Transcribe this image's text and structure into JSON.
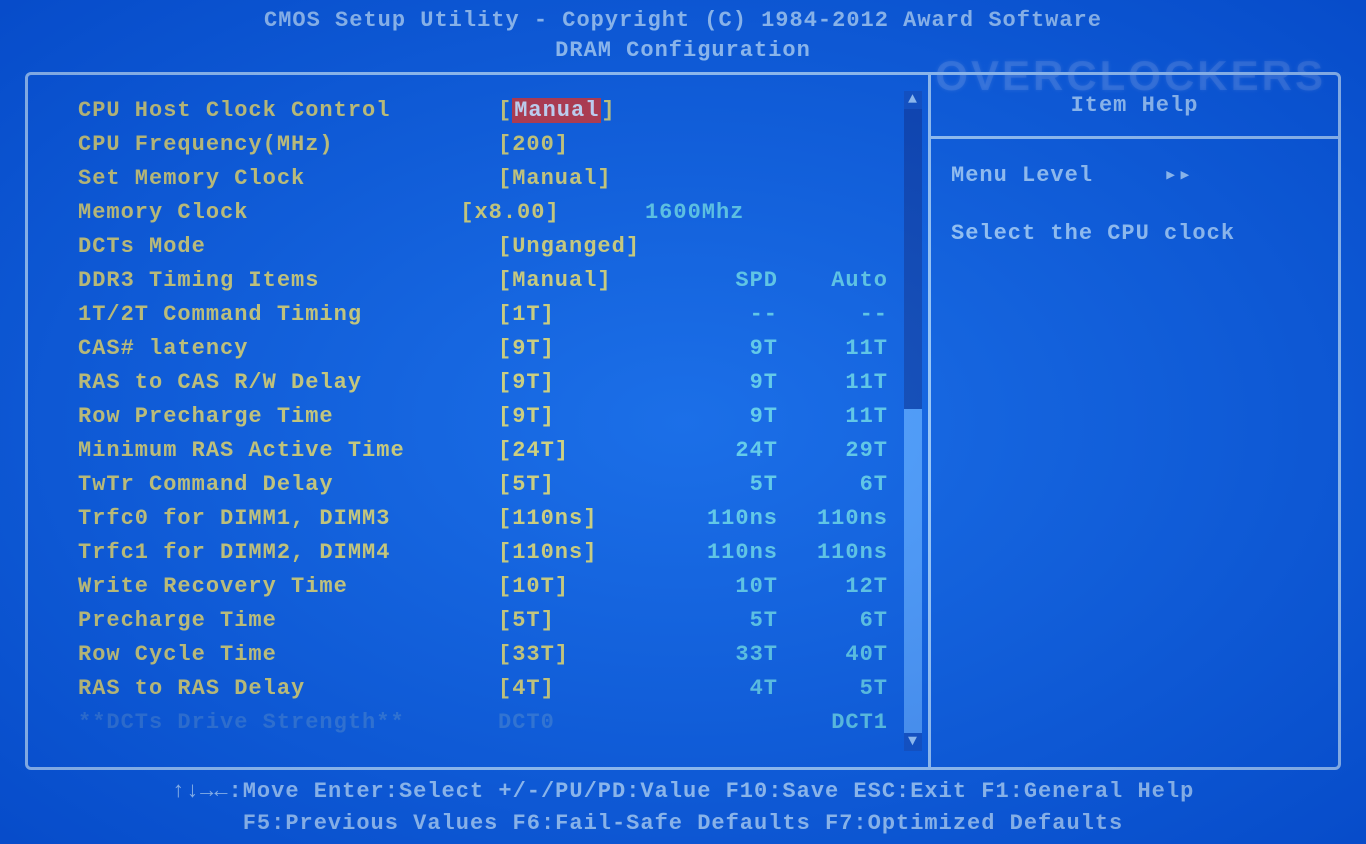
{
  "header": {
    "title": "CMOS Setup Utility - Copyright (C) 1984-2012 Award Software",
    "subtitle": "DRAM Configuration"
  },
  "watermark": "OVERCLOCKERS",
  "settings": [
    {
      "label": "CPU Host Clock Control",
      "value": "Manual",
      "selected": true
    },
    {
      "label": "CPU Frequency(MHz)",
      "value": "200"
    },
    {
      "label": "Set Memory Clock",
      "value": "Manual"
    },
    {
      "label": "Memory Clock",
      "value": "x8.00",
      "note": "1600Mhz"
    },
    {
      "label": "DCTs Mode",
      "value": "Unganged"
    },
    {
      "label": "DDR3 Timing Items",
      "value": "Manual",
      "spd": "SPD",
      "auto": "Auto"
    },
    {
      "label": "1T/2T Command Timing",
      "value": "1T",
      "spd": "--",
      "auto": "--"
    },
    {
      "label": "CAS# latency",
      "value": "9T",
      "spd": "9T",
      "auto": "11T"
    },
    {
      "label": "RAS to CAS R/W Delay",
      "value": "9T",
      "spd": "9T",
      "auto": "11T"
    },
    {
      "label": "Row Precharge Time",
      "value": "9T",
      "spd": "9T",
      "auto": "11T"
    },
    {
      "label": "Minimum RAS Active Time",
      "value": "24T",
      "spd": "24T",
      "auto": "29T"
    },
    {
      "label": "TwTr Command Delay",
      "value": "5T",
      "spd": "5T",
      "auto": "6T"
    },
    {
      "label": "Trfc0 for DIMM1, DIMM3",
      "value": "110ns",
      "spd": "110ns",
      "auto": "110ns"
    },
    {
      "label": "Trfc1 for DIMM2, DIMM4",
      "value": "110ns",
      "spd": "110ns",
      "auto": "110ns"
    },
    {
      "label": "Write Recovery Time",
      "value": "10T",
      "spd": "10T",
      "auto": "12T"
    },
    {
      "label": "Precharge Time",
      "value": "5T",
      "spd": "5T",
      "auto": "6T"
    },
    {
      "label": "Row Cycle Time",
      "value": "33T",
      "spd": "33T",
      "auto": "40T"
    },
    {
      "label": "RAS to RAS Delay",
      "value": "4T",
      "spd": "4T",
      "auto": "5T"
    },
    {
      "label": "**DCTs Drive Strength**",
      "raw_value": "DCT0",
      "raw_auto": "DCT1",
      "dim": true
    }
  ],
  "help": {
    "title": "Item Help",
    "menu_level_label": "Menu Level",
    "menu_level_icon": "▸▸",
    "body": "Select the CPU clock"
  },
  "footer": {
    "line1": "↑↓→←:Move   Enter:Select   +/-/PU/PD:Value   F10:Save   ESC:Exit   F1:General Help",
    "line2": "F5:Previous Values   F6:Fail-Safe Defaults   F7:Optimized Defaults"
  }
}
